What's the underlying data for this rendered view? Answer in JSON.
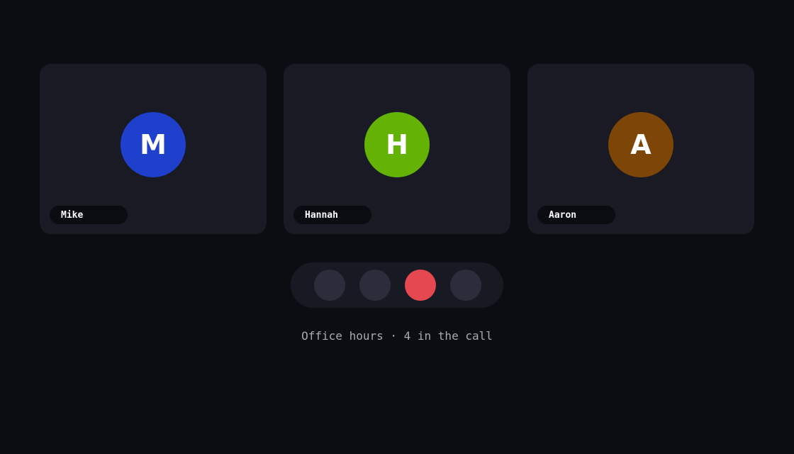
{
  "participants": [
    {
      "initial": "M",
      "name": "Mike",
      "color": "#1f40cc"
    },
    {
      "initial": "H",
      "name": "Hannah",
      "color": "#63b204"
    },
    {
      "initial": "A",
      "name": "Aaron",
      "color": "#7d4606"
    }
  ],
  "controls": {
    "colors": {
      "neutral": "#2b2d3a",
      "danger": "#e5484f"
    },
    "buttons": [
      {
        "icon": "mic-icon",
        "variant": "neutral"
      },
      {
        "icon": "camera-icon",
        "variant": "neutral"
      },
      {
        "icon": "hang-up-icon",
        "variant": "danger"
      },
      {
        "icon": "more-icon",
        "variant": "neutral"
      }
    ]
  },
  "status": {
    "text": "Office hours · 4 in the call"
  },
  "colors": {
    "background": "#0b0d13",
    "tile": "#191a24",
    "name_pill": "#0b0c11"
  }
}
